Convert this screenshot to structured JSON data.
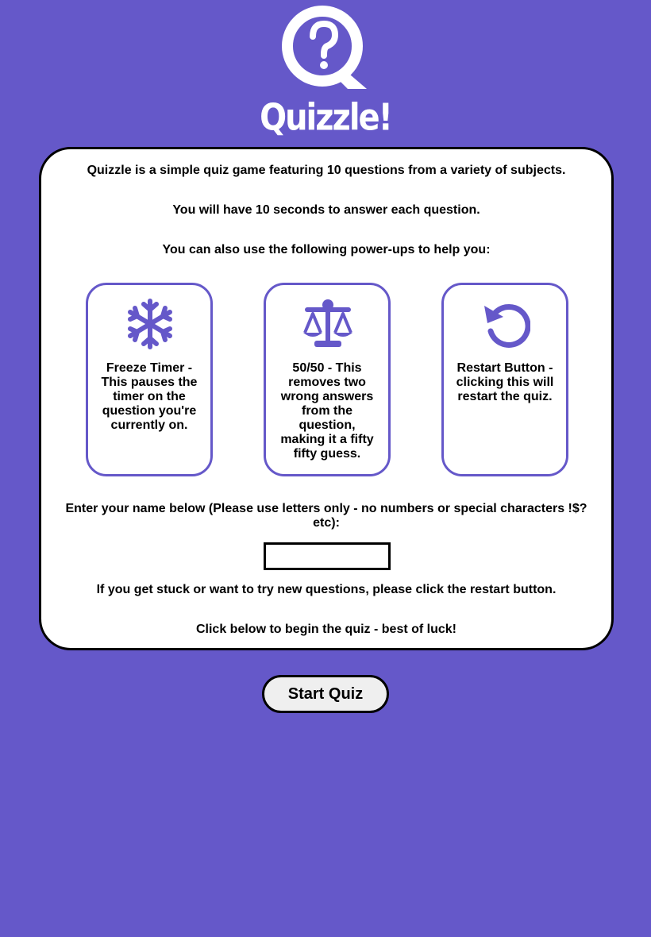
{
  "app": {
    "title": "Quizzle!",
    "logo_icon": "question-mark-magnifier-icon",
    "accent_color": "#6558c9"
  },
  "intro": {
    "line1": "Quizzle is a simple quiz game featuring 10 questions from a variety of subjects.",
    "line2": "You will have 10 seconds to answer each question.",
    "line3": "You can also use the following power-ups to help you:"
  },
  "powerups": [
    {
      "icon": "snowflake-icon",
      "text": "Freeze Timer - This pauses the timer on the question you're currently on."
    },
    {
      "icon": "balance-scale-icon",
      "text": "50/50 - This removes two wrong answers from the question, making it a fifty fifty guess."
    },
    {
      "icon": "restart-arrow-icon",
      "text": "Restart Button - clicking this will restart the quiz."
    }
  ],
  "name_prompt": "Enter your name below (Please use letters only - no numbers or special characters !$? etc):",
  "name_input": {
    "value": "",
    "placeholder": ""
  },
  "restart_hint": "If you get stuck or want to try new questions, please click the restart button.",
  "begin_hint": "Click below to begin the quiz - best of luck!",
  "start_button_label": "Start Quiz"
}
